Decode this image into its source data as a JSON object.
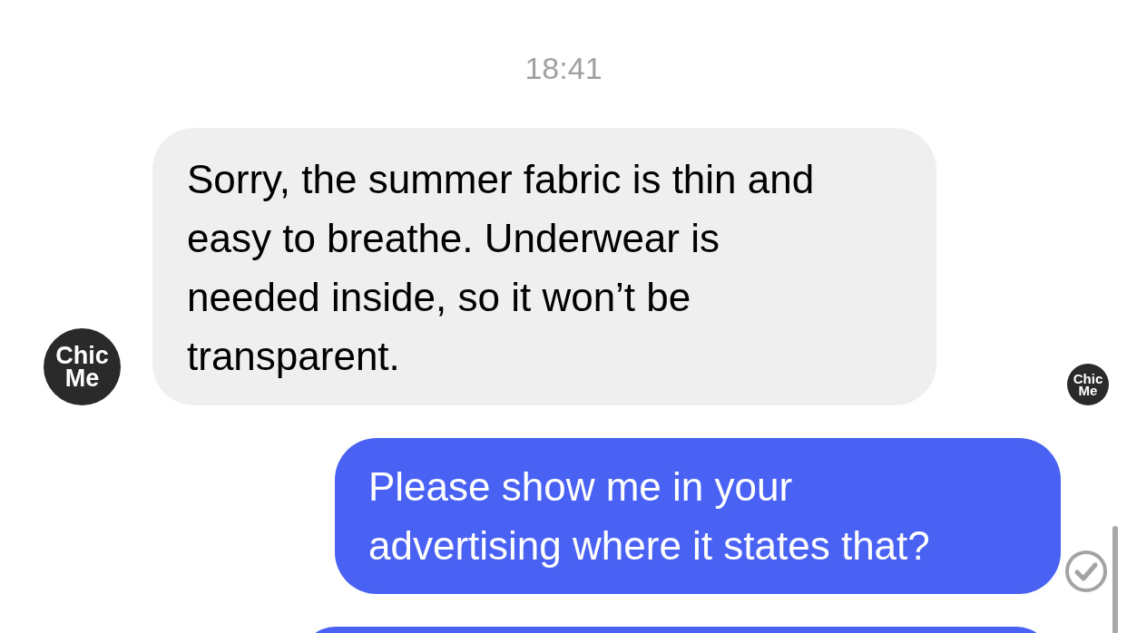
{
  "timestamp": "18:41",
  "messages": [
    {
      "kind": "incoming",
      "text": "Sorry, the summer fabric is thin and easy to breathe. Underwear is needed inside, so it won’t be transparent.",
      "avatar": {
        "logo_text": [
          "Chic",
          "Me"
        ]
      },
      "read_receipt": {
        "logo_text": [
          "Chic",
          "Me"
        ]
      }
    },
    {
      "kind": "outgoing",
      "text": "Please show me in your advertising where it states that?",
      "delivered": true
    },
    {
      "kind": "outgoing"
    }
  ]
}
